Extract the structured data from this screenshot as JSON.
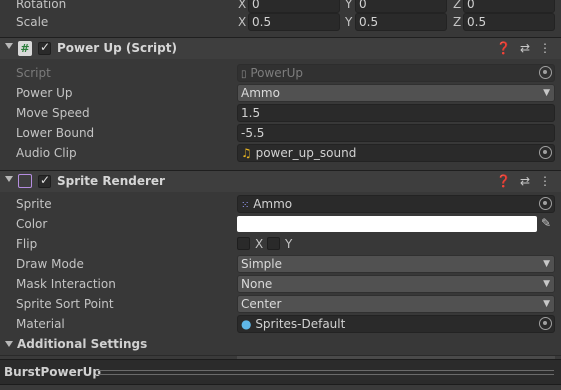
{
  "transform": {
    "rotation": {
      "label": "Rotation",
      "x": "0",
      "y": "0",
      "z": "0"
    },
    "scale": {
      "label": "Scale",
      "x": "0.5",
      "y": "0.5",
      "z": "0.5"
    },
    "axis": {
      "x": "X",
      "y": "Y",
      "z": "Z"
    }
  },
  "powerup": {
    "title": "Power Up (Script)",
    "script_label": "Script",
    "script_value": "PowerUp",
    "powerup_label": "Power Up",
    "powerup_value": "Ammo",
    "speed_label": "Move Speed",
    "speed_value": "1.5",
    "lower_label": "Lower Bound",
    "lower_value": "-5.5",
    "audio_label": "Audio Clip",
    "audio_value": "power_up_sound"
  },
  "sprite_renderer": {
    "title": "Sprite Renderer",
    "sprite_label": "Sprite",
    "sprite_value": "Ammo",
    "color_label": "Color",
    "color_value": "#ffffff",
    "flip_label": "Flip",
    "flip_x": "X",
    "flip_y": "Y",
    "draw_label": "Draw Mode",
    "draw_value": "Simple",
    "mask_label": "Mask Interaction",
    "mask_value": "None",
    "sort_label": "Sprite Sort Point",
    "sort_value": "Center",
    "material_label": "Material",
    "material_value": "Sprites-Default",
    "additional": "Additional Settings"
  },
  "footer": {
    "name": "BurstPowerUp"
  },
  "icons": {
    "help": "help-icon",
    "presets": "presets-icon",
    "menu": "kebab-menu-icon",
    "object_picker": "object-picker-icon",
    "eyedropper": "eyedropper-icon"
  }
}
